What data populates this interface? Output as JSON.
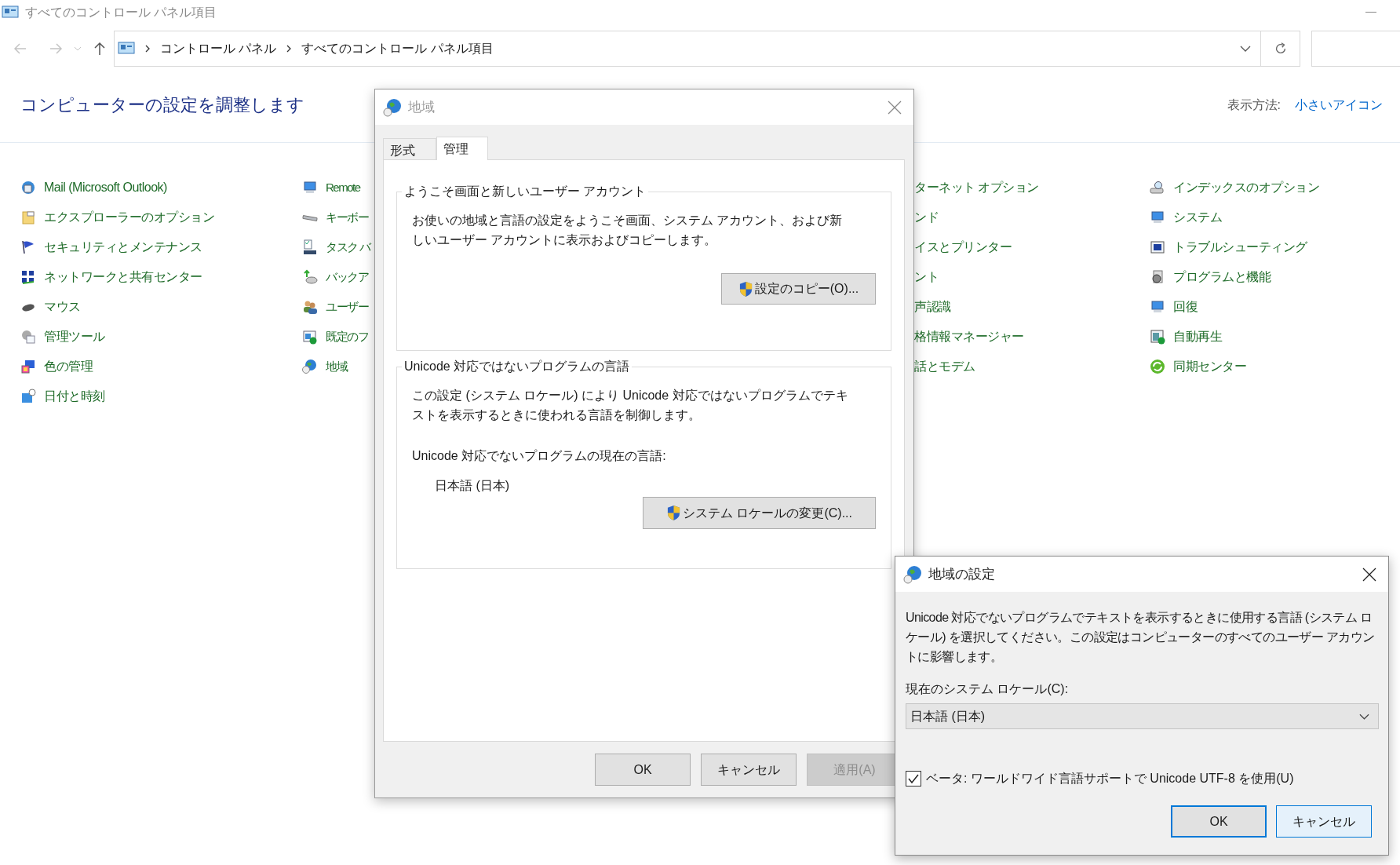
{
  "window": {
    "title": "すべてのコントロール パネル項目"
  },
  "address_bar": {
    "breadcrumbs": [
      "コントロール パネル",
      "すべてのコントロール パネル項目"
    ]
  },
  "header": {
    "heading": "コンピューターの設定を調整します",
    "view_label": "表示方法:",
    "view_value": "小さいアイコン"
  },
  "columns": [
    {
      "items": [
        "Mail (Microsoft Outlook)",
        "エクスプローラーのオプション",
        "セキュリティとメンテナンス",
        "ネットワークと共有センター",
        "マウス",
        "管理ツール",
        "色の管理",
        "日付と時刻"
      ]
    },
    {
      "items": [
        "Remote",
        "キーボー",
        "タスク バ",
        "バックア",
        "ユーザー",
        "既定のフ",
        "地域"
      ]
    },
    {
      "items": [
        "ターネット オプション",
        "ンド",
        "イスとプリンター",
        "ント",
        "声認識",
        "格情報マネージャー",
        "話とモデム"
      ]
    },
    {
      "items": [
        "インデックスのオプション",
        "システム",
        "トラブルシューティング",
        "プログラムと機能",
        "回復",
        "自動再生",
        "同期センター"
      ]
    }
  ],
  "region_dialog": {
    "title": "地域",
    "tabs": [
      {
        "label": "形式",
        "selected": false
      },
      {
        "label": "管理",
        "selected": true
      }
    ],
    "welcome_group": {
      "legend": "ようこそ画面と新しいユーザー アカウント",
      "description": "お使いの地域と言語の設定をようこそ画面、システム アカウント、および新しいユーザー アカウントに表示およびコピーします。",
      "button": "設定のコピー(O)..."
    },
    "unicode_group": {
      "legend": "Unicode 対応ではないプログラムの言語",
      "description": "この設定 (システム ロケール) により Unicode 対応ではないプログラムでテキストを表示するときに使われる言語を制御します。",
      "current_label": "Unicode 対応でないプログラムの現在の言語:",
      "current_value": "日本語 (日本)",
      "button": "システム ロケールの変更(C)..."
    },
    "buttons": [
      {
        "label": "OK",
        "disabled": false
      },
      {
        "label": "キャンセル",
        "disabled": false
      },
      {
        "label": "適用(A)",
        "disabled": true
      }
    ]
  },
  "settings_dialog": {
    "title": "地域の設定",
    "description": "Unicode 対応でないプログラムでテキストを表示するときに使用する言語 (システム ロケール) を選択してください。この設定はコンピューターのすべてのユーザー アカウントに影響します。",
    "locale_label": "現在のシステム ロケール(C):",
    "locale_value": "日本語 (日本)",
    "utf8": {
      "label": "ベータ: ワールドワイド言語サポートで Unicode UTF-8 を使用(U)",
      "checked": true
    },
    "buttons": [
      {
        "label": "OK",
        "default": true,
        "hovered": false
      },
      {
        "label": "キャンセル",
        "default": false,
        "hovered": true
      }
    ]
  }
}
